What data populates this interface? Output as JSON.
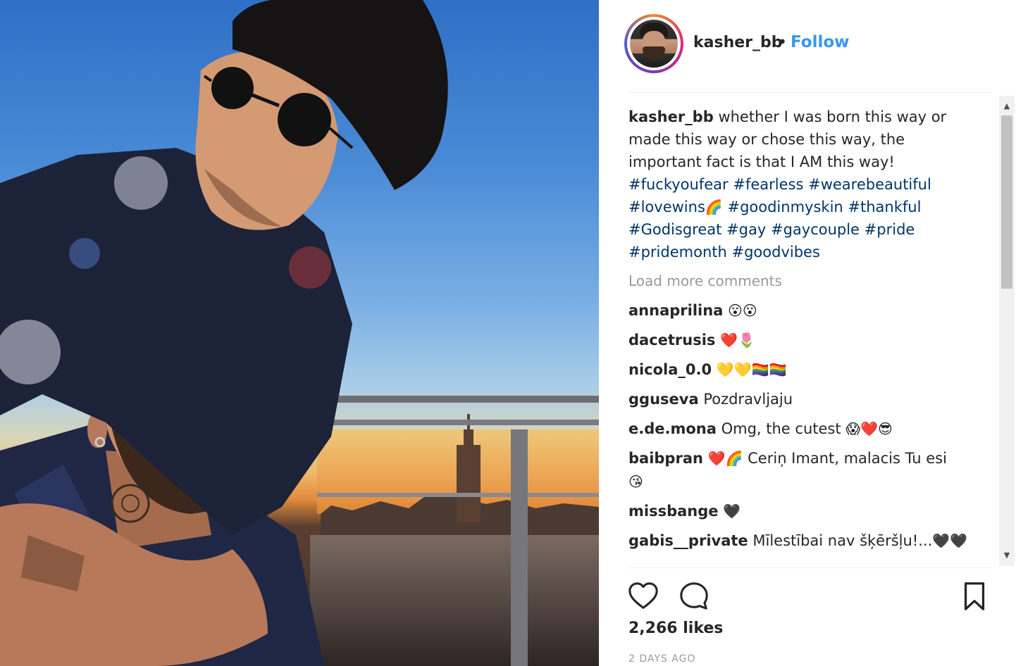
{
  "post": {
    "username": "kasher_bb",
    "separator": "•",
    "follow_label": "Follow",
    "caption_text": "whether I was born this way or made this way or chose this way, the important fact is that I AM this way!",
    "hashtags": [
      "#fuckyoufear",
      "#fearless",
      "#wearebeautiful",
      "#lovewins",
      "#goodinmyskin",
      "#thankful",
      "#Godisgreat",
      "#gay",
      "#gaycouple",
      "#pride",
      "#pridemonth",
      "#goodvibes"
    ],
    "lovewins_emoji": "🌈",
    "load_more_label": "Load more comments",
    "likes": "2,266 likes",
    "timestamp": "2 DAYS AGO"
  },
  "comments": [
    {
      "user": "annaprilina",
      "text": "",
      "emoji": "😮😮"
    },
    {
      "user": "dacetrusis",
      "text": "",
      "emoji": "❤️🌷"
    },
    {
      "user": "nicola_0.0",
      "text": "",
      "emoji": "💛💛🏳️‍🌈🏳️‍🌈"
    },
    {
      "user": "gguseva",
      "text": "Pozdravljaju",
      "emoji": ""
    },
    {
      "user": "e.de.mona",
      "text": "Omg, the cutest",
      "emoji": "😱❤️😎"
    },
    {
      "user": "baibpran",
      "text": "Ceriņ Imant, malacis Tu esi",
      "emoji_before": "❤️🌈",
      "emoji": "😘"
    },
    {
      "user": "missbange",
      "text": "",
      "emoji": "🖤"
    },
    {
      "user": "gabis__private",
      "text": "Mīlestībai nav šķēršļu!...",
      "emoji": "🖤🖤"
    }
  ],
  "icons": {
    "like": "heart-icon",
    "comment": "comment-bubble-icon",
    "save": "bookmark-icon"
  }
}
